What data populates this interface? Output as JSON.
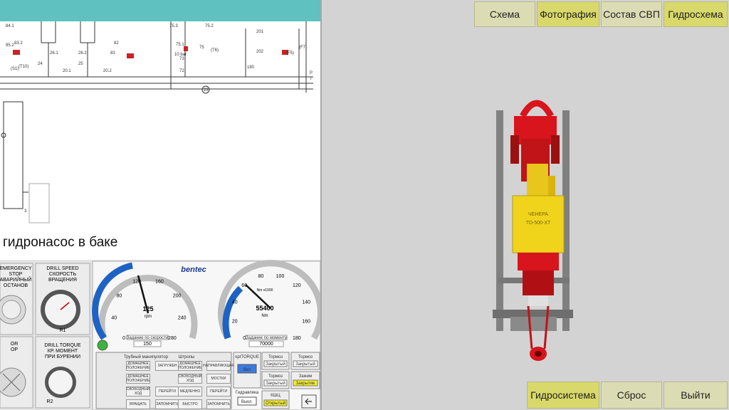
{
  "tabs": [
    {
      "label": "Схема",
      "active": false
    },
    {
      "label": "Фотография",
      "active": true
    },
    {
      "label": "Состав СВП",
      "active": false
    },
    {
      "label": "Гидросхема",
      "active": true
    }
  ],
  "bottom_buttons": [
    {
      "label": "Гидросистема",
      "active": true
    },
    {
      "label": "Сброс",
      "active": false
    },
    {
      "label": "Выйти",
      "active": false
    }
  ],
  "caption": "гидронасос в баке",
  "schematic": {
    "labels": [
      "84.1",
      "85.2",
      "83.2",
      "26.1",
      "26.2",
      "24",
      "25",
      "20.1",
      "20.2",
      "83",
      "82",
      "75.3",
      "75.2",
      "75.1",
      "75",
      "72",
      "73",
      "201",
      "202",
      "(F7)",
      "(T6)",
      "(F5)",
      "180",
      "23",
      "P",
      "T",
      "10 bar",
      "(T10)",
      "(S1)",
      "3"
    ]
  },
  "hmi": {
    "emergency": {
      "label": "EMERGENCY STOP АВАРИЙНЫЙ ОСТАНОВ"
    },
    "drill_speed": {
      "label": "DRILL SPEED СКОРОСТЬ ВРАЩЕНИЯ",
      "tag": "R1"
    },
    "drill_torque": {
      "label": "DRILL TORQUE КР. МОМЕНТ ПРИ БУРЕНИИ",
      "tag": "R2"
    },
    "speed_gauge": {
      "value": "125",
      "unit": "rpm",
      "ticks": [
        "0",
        "40",
        "80",
        "120",
        "160",
        "200",
        "240",
        "280"
      ],
      "setpoint_label": "Задание по скорости",
      "setpoint": "150",
      "setpoint_unit": "rpm"
    },
    "torque_gauge": {
      "value": "55400",
      "unit": "Nm",
      "scale_note": "Nm x1000",
      "ticks": [
        "0",
        "20",
        "40",
        "60",
        "80",
        "100",
        "120",
        "140",
        "160",
        "180"
      ],
      "setpoint_label": "Задание по моменту",
      "setpoint": "70000",
      "setpoint_unit": "Nm"
    },
    "brand": "bentec",
    "pipe_manipulator": "Трубный манипулятор",
    "links": "Штропы",
    "optorque": "optTORQUE",
    "vkl": "Вкл",
    "hydraulics": "Гидравлика",
    "off": "Выкл.",
    "kshts": "КШЦ",
    "open": "Открытый",
    "brake": "Тормоз",
    "closed": "Закрытый",
    "clamp": "Зажим",
    "closing": "Закрытие",
    "panel_buttons": [
      "ДОМАШНЕЕ ПОЛОЖЕНИЕ",
      "ЗАГРУЖЕН",
      "ДОМАШНЕЕ ПОЛОЖЕНИЕ",
      "НАПРАВЛЯЮЩАЯ",
      "ДОМАШНЕЕ ПОЛОЖЕНИЕ",
      "СВОБОДНЫЙ ХОД",
      "МОСТКИ",
      "СВОБОДНЫЙ ХОД",
      "ПЕРЕЙТИ",
      "МЕДЛЕННО",
      "ПЕРЕЙТИ",
      "ВРАЩАТЬ",
      "ЗАПОМНИТЬ",
      "БЫСТРО",
      "ЗАПОМНИТЬ"
    ]
  },
  "top_drive": {
    "plate_line1": "ЧЕНЕРА",
    "plate_line2": "TD-500-XT"
  }
}
